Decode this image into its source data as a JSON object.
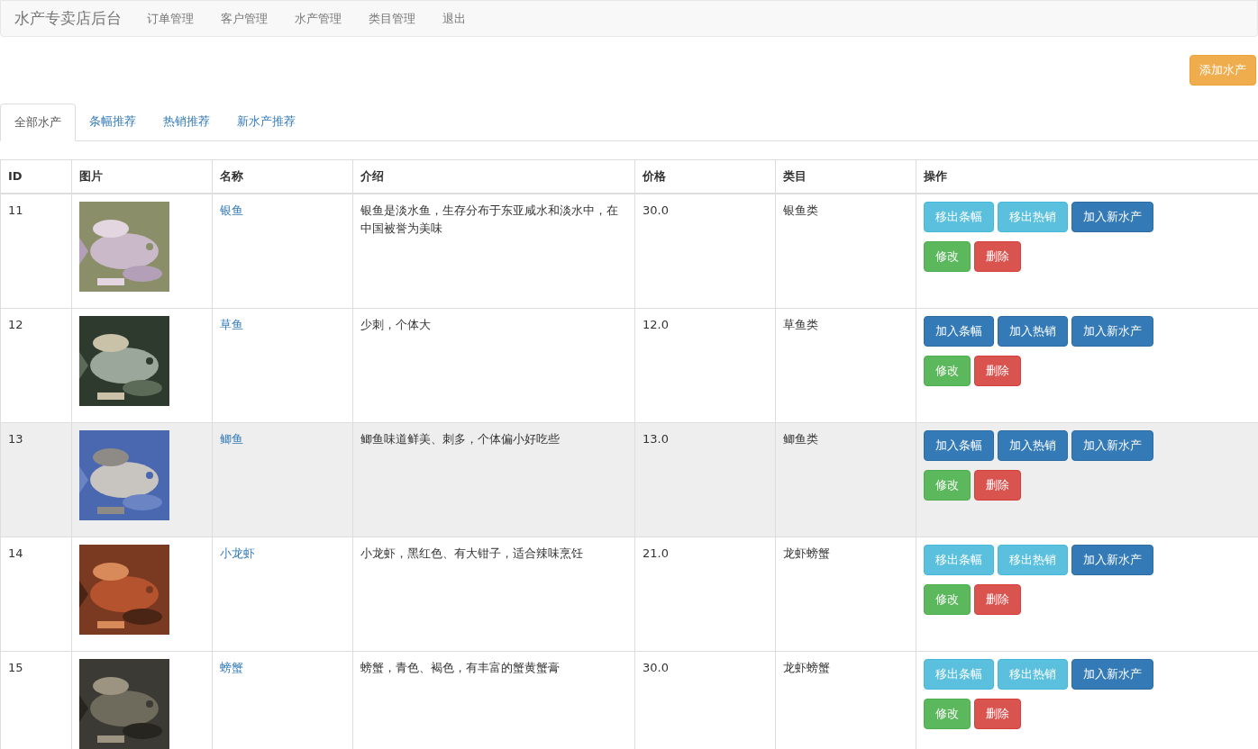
{
  "navbar": {
    "brand": "水产专卖店后台",
    "links": [
      "订单管理",
      "客户管理",
      "水产管理",
      "类目管理",
      "退出"
    ]
  },
  "add_button": "添加水产",
  "tabs": [
    {
      "label": "全部水产",
      "selected": true
    },
    {
      "label": "条幅推荐",
      "selected": false
    },
    {
      "label": "热销推荐",
      "selected": false
    },
    {
      "label": "新水产推荐",
      "selected": false
    }
  ],
  "table": {
    "columns": [
      "ID",
      "图片",
      "名称",
      "介绍",
      "价格",
      "类目",
      "操作"
    ],
    "rows": [
      {
        "id": "11",
        "name": "银鱼",
        "intro": "银鱼是淡水鱼，生存分布于东亚咸水和淡水中，在中国被誉为美味",
        "price": "30.0",
        "category": "银鱼类",
        "highlighted": false,
        "actions": [
          {
            "label": "移出条幅",
            "kind": "info"
          },
          {
            "label": "移出热销",
            "kind": "info"
          },
          {
            "label": "加入新水产",
            "kind": "primary"
          },
          {
            "label": "修改",
            "kind": "success"
          },
          {
            "label": "删除",
            "kind": "danger"
          }
        ]
      },
      {
        "id": "12",
        "name": "草鱼",
        "intro": "少刺，个体大",
        "price": "12.0",
        "category": "草鱼类",
        "highlighted": false,
        "actions": [
          {
            "label": "加入条幅",
            "kind": "primary"
          },
          {
            "label": "加入热销",
            "kind": "primary"
          },
          {
            "label": "加入新水产",
            "kind": "primary"
          },
          {
            "label": "修改",
            "kind": "success"
          },
          {
            "label": "删除",
            "kind": "danger"
          }
        ]
      },
      {
        "id": "13",
        "name": "鲫鱼",
        "intro": "鲫鱼味道鲜美、刺多，个体偏小好吃些",
        "price": "13.0",
        "category": "鲫鱼类",
        "highlighted": true,
        "actions": [
          {
            "label": "加入条幅",
            "kind": "primary"
          },
          {
            "label": "加入热销",
            "kind": "primary"
          },
          {
            "label": "加入新水产",
            "kind": "primary"
          },
          {
            "label": "修改",
            "kind": "success"
          },
          {
            "label": "删除",
            "kind": "danger"
          }
        ]
      },
      {
        "id": "14",
        "name": "小龙虾",
        "intro": "小龙虾，黑红色、有大钳子，适合辣味烹饪",
        "price": "21.0",
        "category": "龙虾螃蟹",
        "highlighted": false,
        "actions": [
          {
            "label": "移出条幅",
            "kind": "info"
          },
          {
            "label": "移出热销",
            "kind": "info"
          },
          {
            "label": "加入新水产",
            "kind": "primary"
          },
          {
            "label": "修改",
            "kind": "success"
          },
          {
            "label": "删除",
            "kind": "danger"
          }
        ]
      },
      {
        "id": "15",
        "name": "螃蟹",
        "intro": "螃蟹，青色、褐色，有丰富的蟹黄蟹膏",
        "price": "30.0",
        "category": "龙虾螃蟹",
        "highlighted": false,
        "actions": [
          {
            "label": "移出条幅",
            "kind": "info"
          },
          {
            "label": "移出热销",
            "kind": "info"
          },
          {
            "label": "加入新水产",
            "kind": "primary"
          },
          {
            "label": "修改",
            "kind": "success"
          },
          {
            "label": "删除",
            "kind": "danger"
          }
        ]
      }
    ]
  }
}
